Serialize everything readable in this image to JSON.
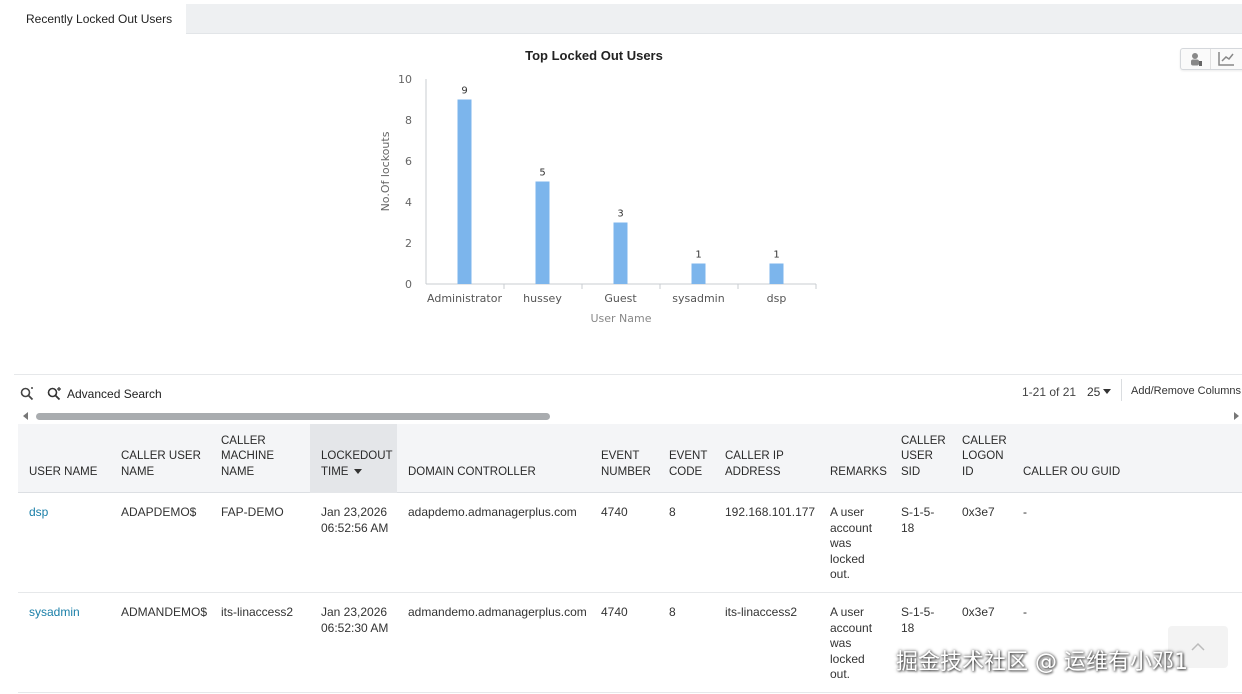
{
  "tabs": [
    {
      "label": "Recently Locked Out Users",
      "active": true
    }
  ],
  "chart_data": {
    "type": "bar",
    "title": "Top Locked Out Users",
    "xlabel": "User Name",
    "ylabel": "No.Of lockouts",
    "categories": [
      "Administrator",
      "hussey",
      "Guest",
      "sysadmin",
      "dsp"
    ],
    "values": [
      9,
      5,
      3,
      1,
      1
    ],
    "ylim": [
      0,
      10
    ],
    "yticks": [
      0,
      2,
      4,
      6,
      8,
      10
    ],
    "data_labels": true,
    "grid": false,
    "bar_color": "#7cb5ec"
  },
  "chart_view_icons": [
    "user-chart-icon",
    "line-chart-icon"
  ],
  "toolbar": {
    "advanced_search": "Advanced Search",
    "range": "1-21 of 21",
    "page_size": "25",
    "add_remove": "Add/Remove Columns"
  },
  "table": {
    "columns": [
      {
        "key": "user_name",
        "label": "USER NAME"
      },
      {
        "key": "caller_user_name",
        "label": "CALLER USER NAME"
      },
      {
        "key": "caller_machine_name",
        "label": "CALLER MACHINE NAME"
      },
      {
        "key": "lockout_time",
        "label": "LOCKEDOUT TIME",
        "sorted": "desc"
      },
      {
        "key": "domain_controller",
        "label": "DOMAIN CONTROLLER"
      },
      {
        "key": "event_number",
        "label": "EVENT NUMBER"
      },
      {
        "key": "event_code",
        "label": "EVENT CODE"
      },
      {
        "key": "caller_ip",
        "label": "CALLER IP ADDRESS"
      },
      {
        "key": "remarks",
        "label": "REMARKS"
      },
      {
        "key": "caller_user_sid",
        "label": "CALLER USER SID"
      },
      {
        "key": "caller_logon_id",
        "label": "CALLER LOGON ID"
      },
      {
        "key": "caller_ou_guid",
        "label": "CALLER OU GUID"
      }
    ],
    "rows": [
      {
        "user_name": "dsp",
        "caller_user_name": "ADAPDEMO$",
        "caller_machine_name": "FAP-DEMO",
        "lockout_time": "Jan 23,2026 06:52:56 AM",
        "domain_controller": "adapdemo.admanagerplus.com",
        "event_number": "4740",
        "event_code": "8",
        "caller_ip": "192.168.101.177",
        "remarks": "A user account was locked out.",
        "caller_user_sid": "S-1-5-18",
        "caller_logon_id": "0x3e7",
        "caller_ou_guid": "-"
      },
      {
        "user_name": "sysadmin",
        "caller_user_name": "ADMANDEMO$",
        "caller_machine_name": "its-linaccess2",
        "lockout_time": "Jan 23,2026 06:52:30 AM",
        "domain_controller": "admandemo.admanagerplus.com",
        "event_number": "4740",
        "event_code": "8",
        "caller_ip": "its-linaccess2",
        "remarks": "A user account was locked out.",
        "caller_user_sid": "S-1-5-18",
        "caller_logon_id": "0x3e7",
        "caller_ou_guid": "-"
      }
    ]
  },
  "watermark": "掘金技术社区 @ 运维有小邓1"
}
